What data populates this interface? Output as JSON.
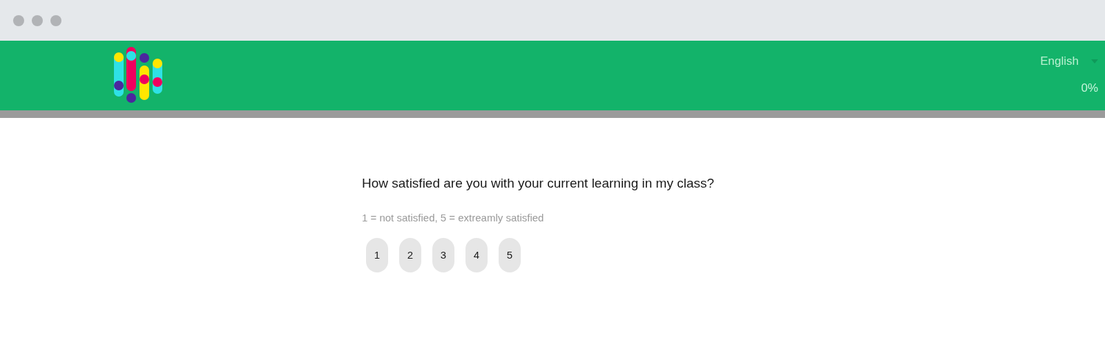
{
  "header": {
    "language": "English",
    "progress": {
      "label": "0%",
      "level": 0
    }
  },
  "question": {
    "title": "How satisfied are you with your current learning in my class?",
    "hint": "1 = not satisfied, 5 = extreamly satisfied",
    "options": [
      {
        "label": "1",
        "selected": false
      },
      {
        "label": "2",
        "selected": false
      },
      {
        "label": "3",
        "selected": false
      },
      {
        "label": "4",
        "selected": false
      },
      {
        "label": "5",
        "selected": false
      }
    ]
  }
}
